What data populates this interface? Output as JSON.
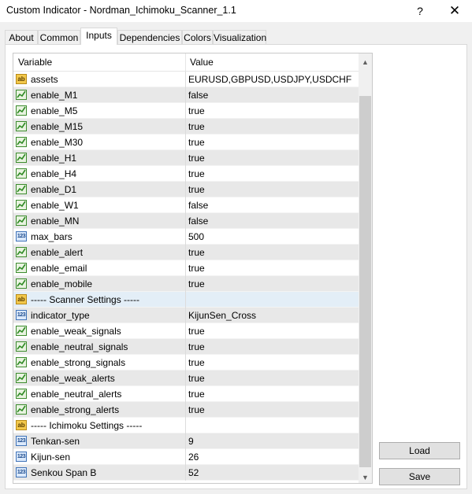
{
  "window": {
    "title": "Custom Indicator - Nordman_Ichimoku_Scanner_1.1",
    "help": "?",
    "close": "✕"
  },
  "tabs": [
    "About",
    "Common",
    "Inputs",
    "Dependencies",
    "Colors",
    "Visualization"
  ],
  "active_tab": "Inputs",
  "grid": {
    "headers": {
      "variable": "Variable",
      "value": "Value"
    },
    "rows": [
      {
        "type": "ab",
        "name": "assets",
        "value": "EURUSD,GBPUSD,USDJPY,USDCHF"
      },
      {
        "type": "bool",
        "name": "enable_M1",
        "value": "false"
      },
      {
        "type": "bool",
        "name": "enable_M5",
        "value": "true"
      },
      {
        "type": "bool",
        "name": "enable_M15",
        "value": "true"
      },
      {
        "type": "bool",
        "name": "enable_M30",
        "value": "true"
      },
      {
        "type": "bool",
        "name": "enable_H1",
        "value": "true"
      },
      {
        "type": "bool",
        "name": "enable_H4",
        "value": "true"
      },
      {
        "type": "bool",
        "name": "enable_D1",
        "value": "true"
      },
      {
        "type": "bool",
        "name": "enable_W1",
        "value": "false"
      },
      {
        "type": "bool",
        "name": "enable_MN",
        "value": "false"
      },
      {
        "type": "num",
        "name": "max_bars",
        "value": "500"
      },
      {
        "type": "bool",
        "name": "enable_alert",
        "value": "true"
      },
      {
        "type": "bool",
        "name": "enable_email",
        "value": "true"
      },
      {
        "type": "bool",
        "name": "enable_mobile",
        "value": "true"
      },
      {
        "type": "ab",
        "name": "----- Scanner Settings -----",
        "value": "",
        "section": true
      },
      {
        "type": "num",
        "name": "indicator_type",
        "value": "KijunSen_Cross"
      },
      {
        "type": "bool",
        "name": "enable_weak_signals",
        "value": "true"
      },
      {
        "type": "bool",
        "name": "enable_neutral_signals",
        "value": "true"
      },
      {
        "type": "bool",
        "name": "enable_strong_signals",
        "value": "true"
      },
      {
        "type": "bool",
        "name": "enable_weak_alerts",
        "value": "true"
      },
      {
        "type": "bool",
        "name": "enable_neutral_alerts",
        "value": "true"
      },
      {
        "type": "bool",
        "name": "enable_strong_alerts",
        "value": "true"
      },
      {
        "type": "ab",
        "name": "----- Ichimoku Settings -----",
        "value": ""
      },
      {
        "type": "num",
        "name": "Tenkan-sen",
        "value": "9"
      },
      {
        "type": "num",
        "name": "Kijun-sen",
        "value": "26"
      },
      {
        "type": "num",
        "name": "Senkou Span B",
        "value": "52"
      }
    ]
  },
  "icons": {
    "ab": "ab",
    "num": "123"
  },
  "buttons": {
    "load": "Load",
    "save": "Save"
  }
}
